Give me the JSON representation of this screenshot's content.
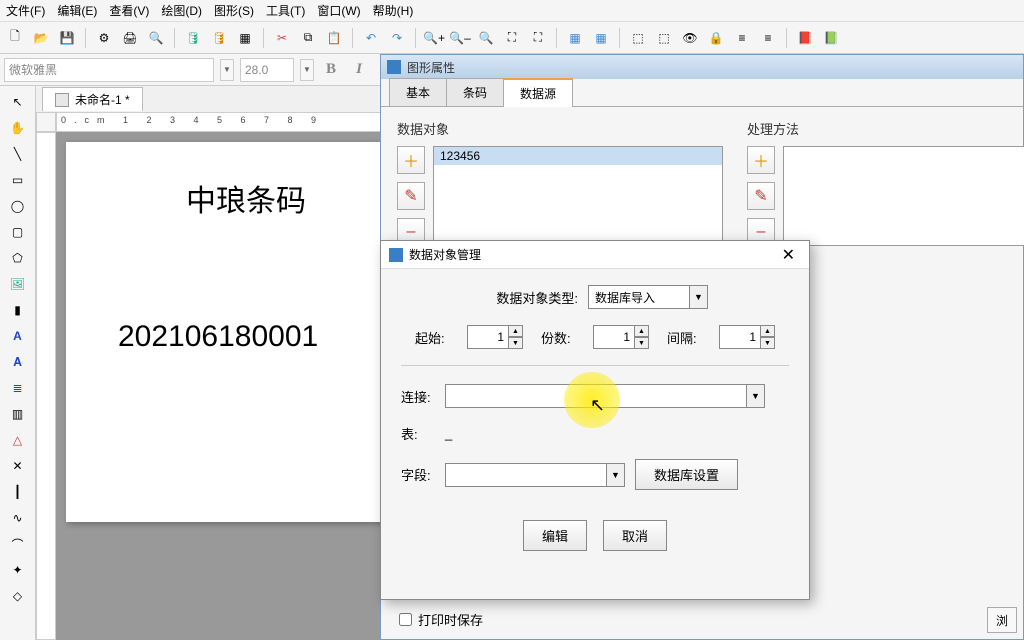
{
  "menu": {
    "file": "文件(F)",
    "edit": "编辑(E)",
    "view": "查看(V)",
    "draw": "绘图(D)",
    "shape": "图形(S)",
    "tool": "工具(T)",
    "window": "窗口(W)",
    "help": "帮助(H)"
  },
  "toolbar2": {
    "font": "微软雅黑",
    "size": "28.0",
    "bold": "B",
    "italic": "I"
  },
  "doc": {
    "tab": "未命名-1 *",
    "ruler": "0.cm 1     2     3     4     5     6     7     8     9"
  },
  "page": {
    "text1": "中琅条码",
    "text2": "202106180001"
  },
  "propPanel": {
    "title": "图形属性",
    "tabs": {
      "basic": "基本",
      "barcode": "条码",
      "dataSource": "数据源"
    },
    "dataObject": "数据对象",
    "dataObjectVal": "123456",
    "method": "处理方法",
    "addIcon": "＋",
    "editIcon": "✎",
    "delIcon": "–",
    "saveOnPrint": "打印时保存",
    "browse": "浏"
  },
  "dialog": {
    "title": "数据对象管理",
    "close": "✕",
    "typeLabel": "数据对象类型:",
    "typeValue": "数据库导入",
    "startLabel": "起始:",
    "startVal": "1",
    "copiesLabel": "份数:",
    "copiesVal": "1",
    "intervalLabel": "间隔:",
    "intervalVal": "1",
    "connLabel": "连接:",
    "connVal": "",
    "tableLabel": "表:",
    "tableVal": "_",
    "fieldLabel": "字段:",
    "fieldVal": "",
    "dbSettings": "数据库设置",
    "editBtn": "编辑",
    "cancelBtn": "取消"
  },
  "icons": {
    "new": "🗋",
    "open": "📂",
    "save": "💾",
    "gear": "⚙",
    "print": "🖨",
    "preview": "🔍",
    "db1": "🛢",
    "db2": "🛢",
    "grid": "▦",
    "cut": "✂",
    "copy": "⧉",
    "paste": "📋",
    "undo": "↶",
    "redo": "↷",
    "zoomin": "🔍+",
    "zoomout": "🔍–",
    "zoom": "🔍",
    "fit": "⛶",
    "fit2": "⛶",
    "r1": "▦",
    "r2": "▦",
    "g1": "⬚",
    "g2": "⬚",
    "eye": "👁",
    "lock": "🔒",
    "align1": "≡",
    "align2": "≡",
    "pdf": "📕",
    "excel": "📗",
    "arrow": "↖",
    "pan": "✋",
    "line": "╲",
    "rect": "▭",
    "oval": "◯",
    "rrect": "▢",
    "poly": "⬠",
    "img": "🖼",
    "code": "▮",
    "text": "A",
    "vtext": "𝐀",
    "hline": "≣",
    "barcode": "▥",
    "tri": "△",
    "cross": "✕",
    "vbar": "┃",
    "curve1": "∿",
    "curve2": "⌒",
    "star": "✦",
    "diamond": "◇"
  }
}
